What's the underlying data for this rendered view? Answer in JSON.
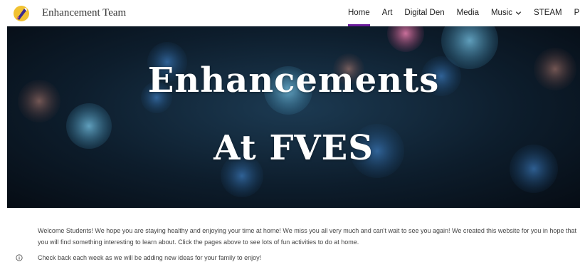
{
  "header": {
    "site_title": "Enhancement Team",
    "logo_icon": "space-shuttle-icon",
    "nav": [
      {
        "label": "Home",
        "active": true
      },
      {
        "label": "Art"
      },
      {
        "label": "Digital Den"
      },
      {
        "label": "Media"
      },
      {
        "label": "Music",
        "has_dropdown": true
      },
      {
        "label": "STEAM"
      },
      {
        "label": "PE"
      }
    ],
    "accent_color": "#6a1a9a"
  },
  "hero": {
    "line1": "Enhancements",
    "line2": "At FVES"
  },
  "main": {
    "welcome_text": "Welcome Students!  We hope you are staying healthy and enjoying your time at home!  We miss you all very much and can't wait to see you again!  We created this website for you in hope that you will find something interesting to learn about.   Click the pages above to see lots of fun activities to do at home.",
    "info_text": "Check back each week as we will be adding new ideas for your family to enjoy!",
    "info_icon": "info-icon"
  }
}
